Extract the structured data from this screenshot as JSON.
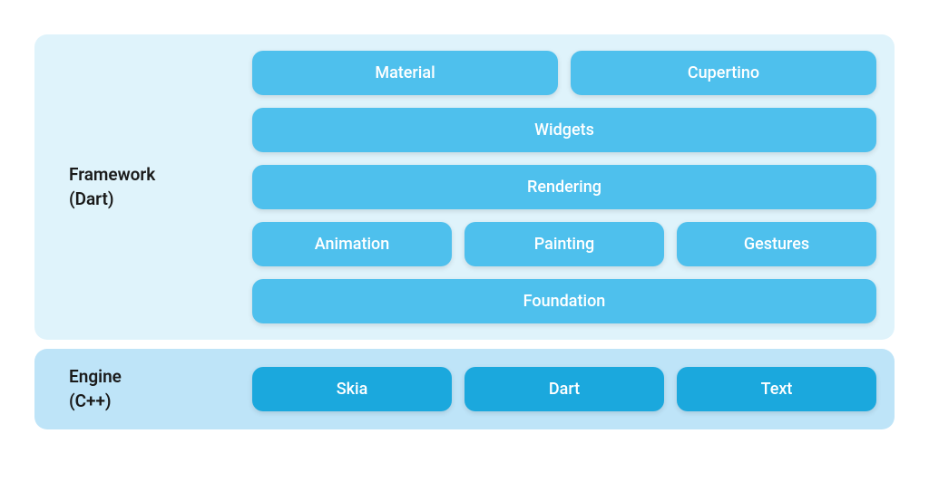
{
  "framework": {
    "label_line1": "Framework",
    "label_line2": "(Dart)",
    "rows": [
      [
        "Material",
        "Cupertino"
      ],
      [
        "Widgets"
      ],
      [
        "Rendering"
      ],
      [
        "Animation",
        "Painting",
        "Gestures"
      ],
      [
        "Foundation"
      ]
    ]
  },
  "engine": {
    "label_line1": "Engine",
    "label_line2": "(C++)",
    "rows": [
      [
        "Skia",
        "Dart",
        "Text"
      ]
    ]
  }
}
